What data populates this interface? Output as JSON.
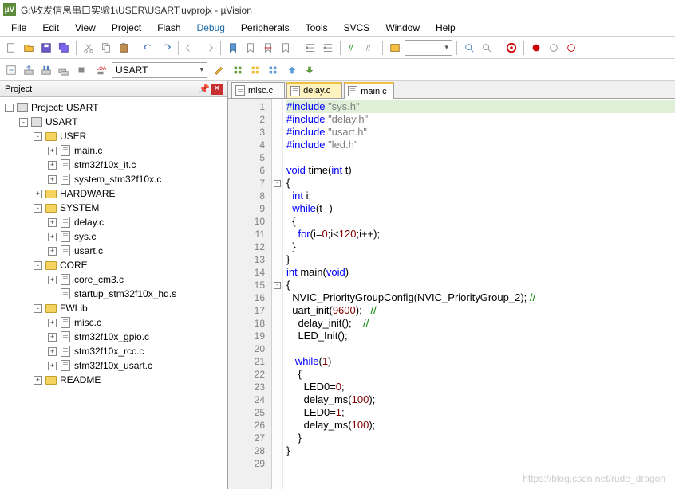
{
  "title": "G:\\收发信息串口实验1\\USER\\USART.uvprojx - µVision",
  "app_icon": "µV",
  "menu": [
    "File",
    "Edit",
    "View",
    "Project",
    "Flash",
    "Debug",
    "Peripherals",
    "Tools",
    "SVCS",
    "Window",
    "Help"
  ],
  "menu_active": "Debug",
  "target_combo": "USART",
  "project_panel": {
    "title": "Project"
  },
  "tree": [
    {
      "d": 0,
      "exp": "-",
      "ico": "target",
      "label": "Project: USART"
    },
    {
      "d": 1,
      "exp": "-",
      "ico": "target",
      "label": "USART"
    },
    {
      "d": 2,
      "exp": "-",
      "ico": "folder-open",
      "label": "USER"
    },
    {
      "d": 3,
      "exp": "+",
      "ico": "file",
      "label": "main.c"
    },
    {
      "d": 3,
      "exp": "+",
      "ico": "file",
      "label": "stm32f10x_it.c"
    },
    {
      "d": 3,
      "exp": "+",
      "ico": "file",
      "label": "system_stm32f10x.c"
    },
    {
      "d": 2,
      "exp": "+",
      "ico": "folder",
      "label": "HARDWARE"
    },
    {
      "d": 2,
      "exp": "-",
      "ico": "folder-open",
      "label": "SYSTEM"
    },
    {
      "d": 3,
      "exp": "+",
      "ico": "file",
      "label": "delay.c"
    },
    {
      "d": 3,
      "exp": "+",
      "ico": "file",
      "label": "sys.c"
    },
    {
      "d": 3,
      "exp": "+",
      "ico": "file",
      "label": "usart.c"
    },
    {
      "d": 2,
      "exp": "-",
      "ico": "folder-open",
      "label": "CORE"
    },
    {
      "d": 3,
      "exp": "+",
      "ico": "file",
      "label": "core_cm3.c"
    },
    {
      "d": 3,
      "exp": " ",
      "ico": "file",
      "label": "startup_stm32f10x_hd.s"
    },
    {
      "d": 2,
      "exp": "-",
      "ico": "folder-open",
      "label": "FWLib"
    },
    {
      "d": 3,
      "exp": "+",
      "ico": "file",
      "label": "misc.c"
    },
    {
      "d": 3,
      "exp": "+",
      "ico": "file",
      "label": "stm32f10x_gpio.c"
    },
    {
      "d": 3,
      "exp": "+",
      "ico": "file",
      "label": "stm32f10x_rcc.c"
    },
    {
      "d": 3,
      "exp": "+",
      "ico": "file",
      "label": "stm32f10x_usart.c"
    },
    {
      "d": 2,
      "exp": "+",
      "ico": "folder",
      "label": "README"
    }
  ],
  "tabs": [
    {
      "label": "misc.c",
      "active": false,
      "style": "plain"
    },
    {
      "label": "delay.c",
      "active": false,
      "style": "yellow"
    },
    {
      "label": "main.c",
      "active": true,
      "style": "active"
    }
  ],
  "code": {
    "lines": [
      {
        "n": 1,
        "hl": true,
        "fold": "",
        "html": "<span class='pp'>#include</span> <span class='str'>\"sys.h\"</span>"
      },
      {
        "n": 2,
        "fold": "",
        "html": "<span class='pp'>#include</span> <span class='str'>\"delay.h\"</span>"
      },
      {
        "n": 3,
        "fold": "",
        "html": "<span class='pp'>#include</span> <span class='str'>\"usart.h\"</span>"
      },
      {
        "n": 4,
        "fold": "",
        "html": "<span class='pp'>#include</span> <span class='str'>\"led.h\"</span>"
      },
      {
        "n": 5,
        "fold": "",
        "html": ""
      },
      {
        "n": 6,
        "fold": "",
        "html": "<span class='kw'>void</span> time(<span class='kw'>int</span> t)"
      },
      {
        "n": 7,
        "fold": "-",
        "html": "{"
      },
      {
        "n": 8,
        "fold": "",
        "html": "  <span class='kw'>int</span> i;"
      },
      {
        "n": 9,
        "fold": "",
        "html": "  <span class='kw'>while</span>(t--)"
      },
      {
        "n": 10,
        "fold": "",
        "html": "  {"
      },
      {
        "n": 11,
        "fold": "",
        "html": "    <span class='kw'>for</span>(i=<span class='num'>0</span>;i&lt;<span class='num'>120</span>;i++);"
      },
      {
        "n": 12,
        "fold": "",
        "html": "  }"
      },
      {
        "n": 13,
        "fold": "",
        "html": "}"
      },
      {
        "n": 14,
        "fold": "",
        "html": "<span class='kw'>int</span> main(<span class='kw'>void</span>)"
      },
      {
        "n": 15,
        "fold": "-",
        "html": "{"
      },
      {
        "n": 16,
        "fold": "",
        "html": "  NVIC_PriorityGroupConfig(NVIC_PriorityGroup_2); <span class='cmt'>//</span>"
      },
      {
        "n": 17,
        "fold": "",
        "html": "  uart_init(<span class='num'>9600</span>);   <span class='cmt'>//</span>"
      },
      {
        "n": 18,
        "fold": "",
        "html": "    delay_init();    <span class='cmt'>//</span>"
      },
      {
        "n": 19,
        "fold": "",
        "html": "    LED_Init();"
      },
      {
        "n": 20,
        "fold": "",
        "html": ""
      },
      {
        "n": 21,
        "fold": "",
        "html": "   <span class='kw'>while</span>(<span class='num'>1</span>)"
      },
      {
        "n": 22,
        "fold": "",
        "html": "    {"
      },
      {
        "n": 23,
        "fold": "",
        "html": "      LED0=<span class='num'>0</span>;"
      },
      {
        "n": 24,
        "fold": "",
        "html": "      delay_ms(<span class='num'>100</span>);"
      },
      {
        "n": 25,
        "fold": "",
        "html": "      LED0=<span class='num'>1</span>;"
      },
      {
        "n": 26,
        "fold": "",
        "html": "      delay_ms(<span class='num'>100</span>);"
      },
      {
        "n": 27,
        "fold": "",
        "html": "    }"
      },
      {
        "n": 28,
        "fold": "",
        "html": "}"
      },
      {
        "n": 29,
        "fold": "",
        "html": ""
      }
    ]
  },
  "watermark": "https://blog.csdn.net/rude_dragon"
}
